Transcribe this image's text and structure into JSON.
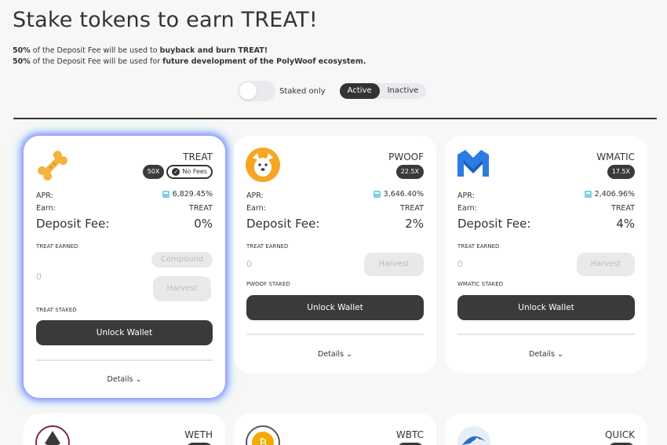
{
  "header": {
    "title": "Stake tokens to earn TREAT!",
    "fee_line1_pct": "50%",
    "fee_line1_mid": " of the Deposit Fee will be used to ",
    "fee_line1_bold": "buyback and burn TREAT!",
    "fee_line2_pct": "50%",
    "fee_line2_mid": " of the Deposit Fee will be used for ",
    "fee_line2_bold": "future development of the PolyWoof ecosystem."
  },
  "controls": {
    "staked_only_label": "Staked only",
    "active_label": "Active",
    "inactive_label": "Inactive"
  },
  "labels": {
    "apr": "APR:",
    "earn": "Earn:",
    "deposit_fee": "Deposit Fee:",
    "compound": "Compound",
    "harvest": "Harvest",
    "unlock_wallet": "Unlock Wallet",
    "details": "Details",
    "chevron": "⌄"
  },
  "cards": [
    {
      "name": "TREAT",
      "icon": "bone-icon",
      "multiplier": "50X",
      "no_fees": "No Fees",
      "apr": "6,829.45%",
      "earn": "TREAT",
      "deposit_fee": "0%",
      "earned_label": "TREAT EARNED",
      "earned_value": "0",
      "staked_label": "TREAT STAKED"
    },
    {
      "name": "PWOOF",
      "icon": "dog-icon",
      "multiplier": "22.5X",
      "apr": "3,646.40%",
      "earn": "TREAT",
      "deposit_fee": "2%",
      "earned_label": "TREAT EARNED",
      "earned_value": "0",
      "staked_label": "PWOOF STAKED"
    },
    {
      "name": "WMATIC",
      "icon": "matic-icon",
      "multiplier": "17.5X",
      "apr": "2,406.96%",
      "earn": "TREAT",
      "deposit_fee": "4%",
      "earned_label": "TREAT EARNED",
      "earned_value": "0",
      "staked_label": "WMATIC STAKED"
    }
  ],
  "bottom_cards": [
    {
      "name": "WETH",
      "icon": "eth-icon"
    },
    {
      "name": "WBTC",
      "icon": "btc-icon"
    },
    {
      "name": "QUICK",
      "icon": "quick-icon"
    }
  ],
  "colors": {
    "dark": "#3a3a3a",
    "background": "#f7f7f7",
    "disabled": "#e9e9ea",
    "apr_icon": "#7fd0e6",
    "pwoof_orange": "#f5a623",
    "matic_blue": "#2a7de1",
    "bone": "#f3b43f"
  }
}
